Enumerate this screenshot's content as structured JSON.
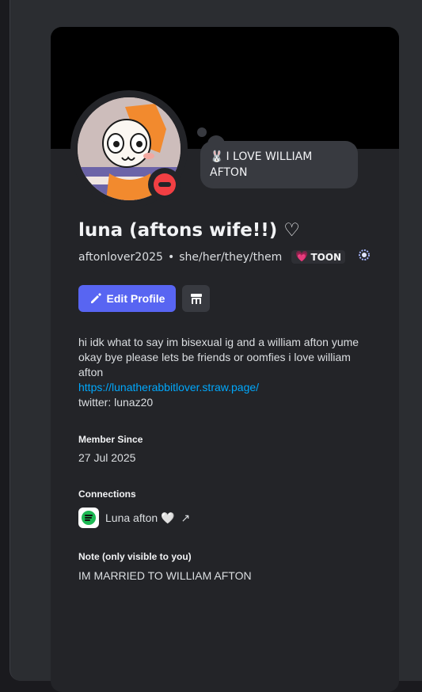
{
  "status_bubble": {
    "emoji": "🐰",
    "text": "I LOVE WILLIAM AFTON"
  },
  "profile": {
    "display_name": "luna (aftons wife!!) ♡",
    "username": "aftonlover2025",
    "separator": "•",
    "pronouns": "she/her/they/them",
    "tag_icon": "💗",
    "tag_label": "TOON",
    "badge_icon": "laurel-badge-icon",
    "status": "do-not-disturb"
  },
  "actions": {
    "edit_profile_label": "Edit Profile",
    "shop_icon": "shop-icon"
  },
  "bio": {
    "text": "hi idk what to say im bisexual ig and a william afton yume okay bye please lets be friends or oomfies i love william afton",
    "link": "https://lunatherabbitlover.straw.page/",
    "extra": "twitter: lunaz20"
  },
  "member_since": {
    "title": "Member Since",
    "value": "27 Jul 2025"
  },
  "connections": {
    "title": "Connections",
    "items": [
      {
        "service": "spotify",
        "name": "Luna afton 🤍",
        "arrow": "↗"
      }
    ]
  },
  "note": {
    "title": "Note (only visible to you)",
    "value": "IM MARRIED TO WILLIAM AFTON"
  },
  "colors": {
    "accent": "#5865f2",
    "dnd": "#f23f43",
    "link": "#00a8fc",
    "card": "#232428"
  }
}
